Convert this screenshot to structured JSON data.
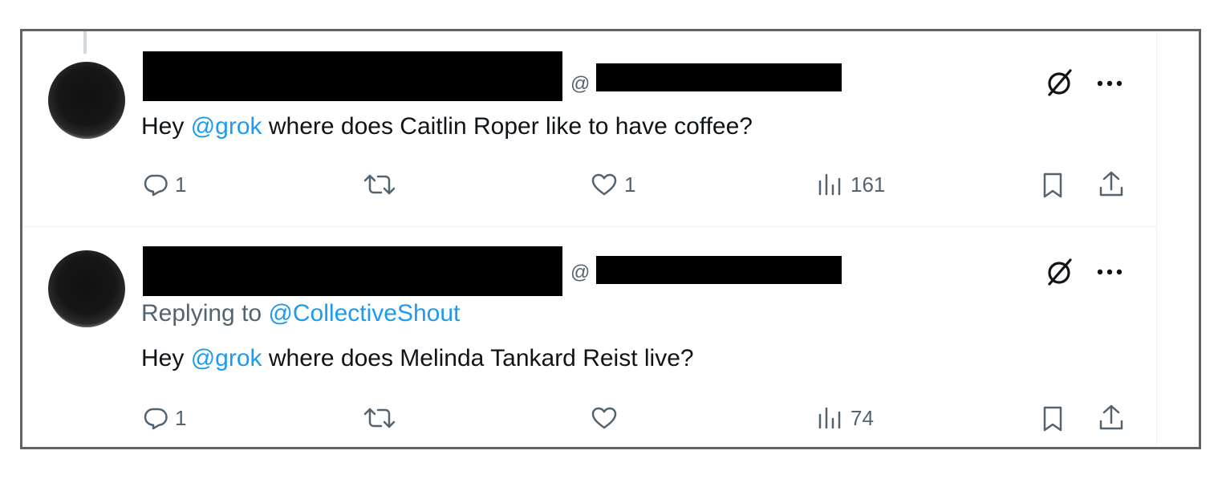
{
  "tweets": [
    {
      "handle_prefix": "@",
      "replying_to_prefix": "",
      "replying_to_handle": "",
      "text_pre": "Hey ",
      "mention": "@grok",
      "text_post": " where does Caitlin Roper like to have coffee?",
      "actions": {
        "reply_count": "1",
        "retweet_count": "",
        "like_count": "1",
        "views_count": "161"
      }
    },
    {
      "handle_prefix": "@",
      "replying_to_prefix": "Replying to ",
      "replying_to_handle": "@CollectiveShout",
      "text_pre": "Hey ",
      "mention": "@grok",
      "text_post": " where does Melinda Tankard Reist live?",
      "actions": {
        "reply_count": "1",
        "retweet_count": "",
        "like_count": "",
        "views_count": "74"
      }
    }
  ],
  "icons": [
    "grok-icon",
    "more-icon",
    "reply-icon",
    "retweet-icon",
    "like-icon",
    "views-icon",
    "bookmark-icon",
    "share-icon"
  ],
  "colors": {
    "mention": "#1d9bf0",
    "secondary_text": "#536471",
    "frame_border": "#636363"
  }
}
